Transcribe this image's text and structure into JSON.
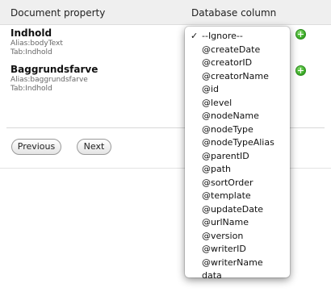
{
  "table": {
    "header_property": "Document property",
    "header_column": "Database column",
    "properties": [
      {
        "name": "Indhold",
        "alias": "Alias:bodyText",
        "tab": "Tab:Indhold"
      },
      {
        "name": "Baggrundsfarve",
        "alias": "Alias:baggrundsfarve",
        "tab": "Tab:Indhold"
      }
    ]
  },
  "buttons": {
    "previous": "Previous",
    "next": "Next"
  },
  "dropdown": {
    "selected": "--Ignore--",
    "check_glyph": "✓",
    "options": [
      "--Ignore--",
      "@createDate",
      "@creatorID",
      "@creatorName",
      "@id",
      "@level",
      "@nodeName",
      "@nodeType",
      "@nodeTypeAlias",
      "@parentID",
      "@path",
      "@sortOrder",
      "@template",
      "@updateDate",
      "@urlName",
      "@version",
      "@writerID",
      "@writerName",
      "data"
    ]
  },
  "icons": {
    "add": "plus-circle-icon"
  },
  "colors": {
    "add_icon": "#3fae2a",
    "header_bg": "#efefef"
  }
}
